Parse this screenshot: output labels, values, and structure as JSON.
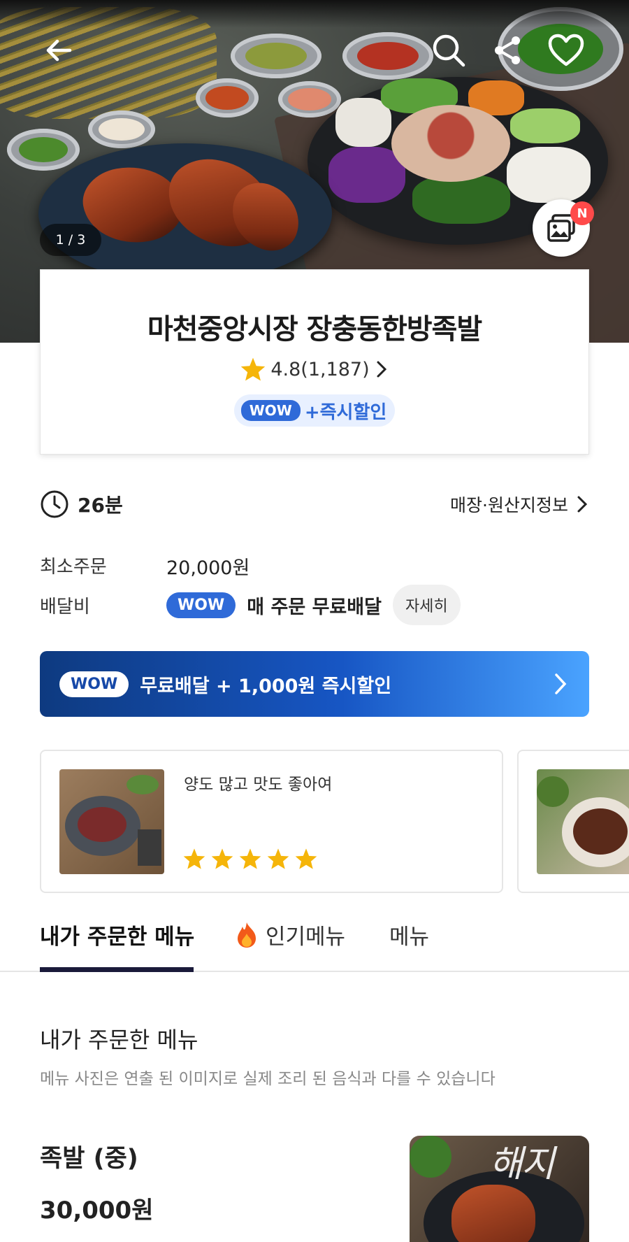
{
  "hero": {
    "image_counter": "1 / 3",
    "gallery_badge": "N",
    "icons": [
      "back-arrow-icon",
      "search-icon",
      "share-icon",
      "heart-icon",
      "gallery-icon"
    ]
  },
  "store": {
    "name": "마천중앙시장 장충동한방족발",
    "rating": "4.8(1,187)",
    "wow_label": "WOW",
    "wow_chip_text": "+즉시할인"
  },
  "delivery": {
    "time": "26분",
    "origin_link": "매장·원산지정보",
    "min_order_label": "최소주문",
    "min_order_value": "20,000원",
    "fee_label": "배달비",
    "fee_wow": "WOW",
    "fee_text": "매 주문 무료배달",
    "detail_button": "자세히"
  },
  "promo": {
    "wow": "WOW",
    "text": "무료배달 + 1,000원 즉시할인"
  },
  "reviews": [
    {
      "text": "양도 많고 맛도 좋아여",
      "stars": 5
    }
  ],
  "tabs": [
    {
      "label": "내가 주문한 메뉴",
      "active": true
    },
    {
      "label": "인기메뉴",
      "icon": "fire-icon"
    },
    {
      "label": "메뉴"
    }
  ],
  "section": {
    "title": "내가 주문한 메뉴",
    "desc": "메뉴 사진은 연출 된 이미지로 실제 조리 된 음식과 다를 수 있습니다"
  },
  "menu_item": {
    "name": "족발 (중)",
    "price": "30,000원",
    "watermark": "해지"
  },
  "colors": {
    "wow_blue": "#2f6ad8",
    "promo_start": "#0e3a80",
    "promo_end": "#4aa3ff",
    "star": "#f5b50a",
    "tab_underline": "#1a1a3a"
  }
}
